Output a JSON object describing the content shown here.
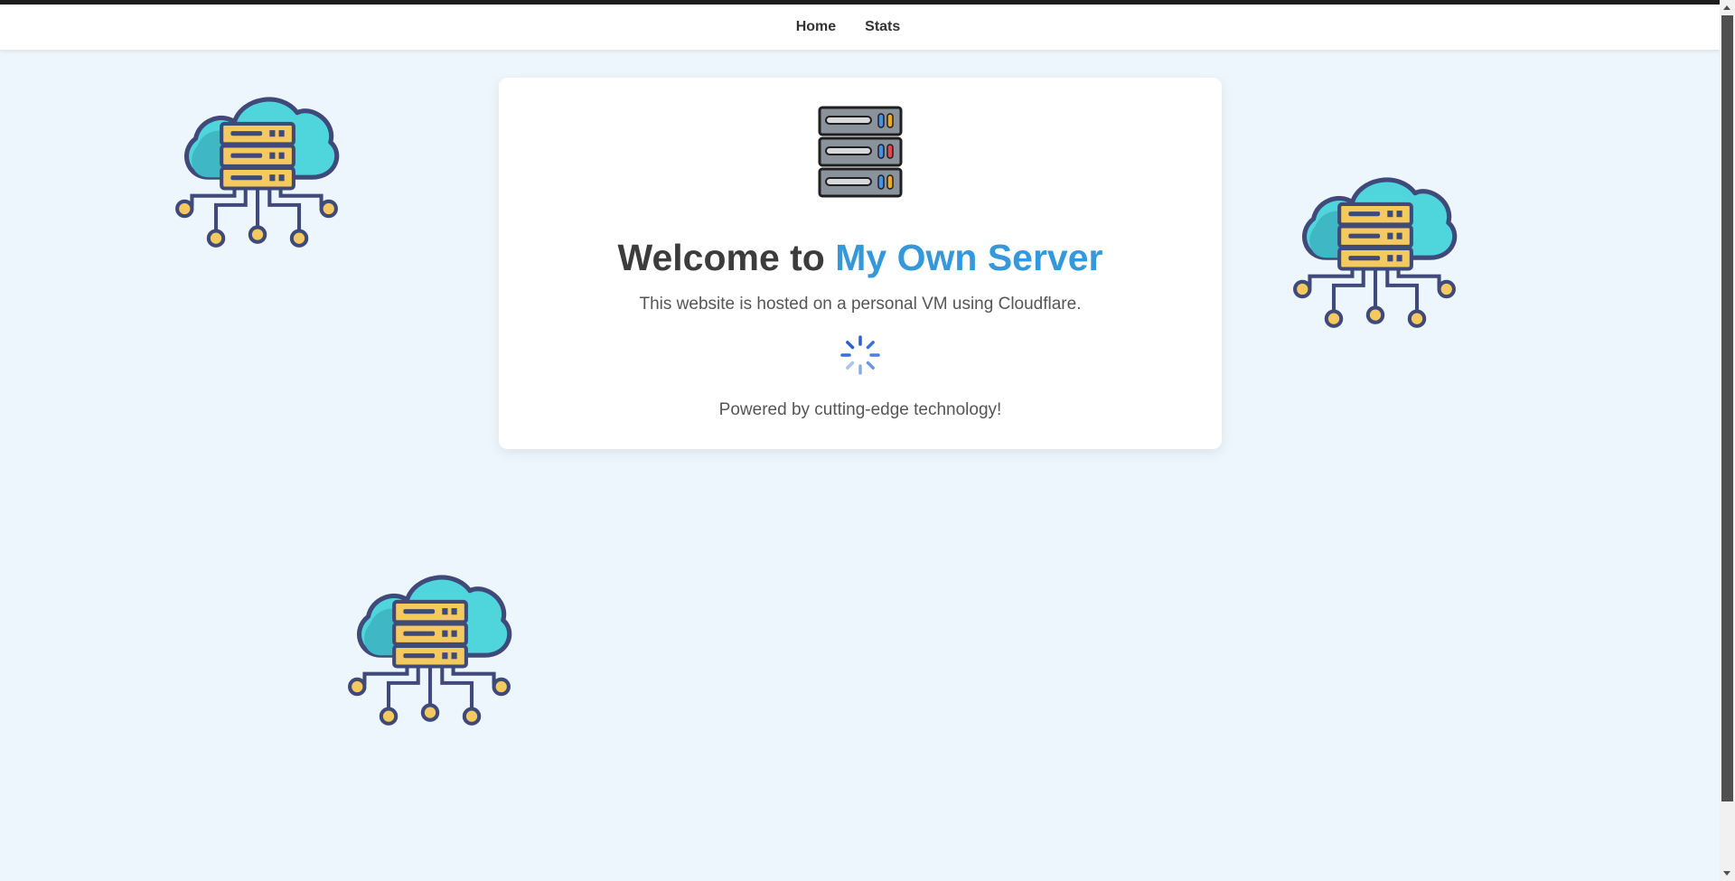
{
  "nav": {
    "home_label": "Home",
    "stats_label": "Stats"
  },
  "hero": {
    "headline_prefix": "Welcome to",
    "headline_accent": "My Own Server",
    "subtitle": "This website is hosted on a personal VM using Cloudflare.",
    "footer_text": "Powered by cutting-edge technology!"
  },
  "icons": {
    "logo": "server-rack-icon",
    "loader": "loading-spinner-icon",
    "decoration": "cloud-server-icon"
  },
  "colors": {
    "background": "#eef6fd",
    "accent": "#3498db",
    "heading": "#3c3c3c",
    "body_text": "#555555",
    "nav_text": "#333333"
  }
}
